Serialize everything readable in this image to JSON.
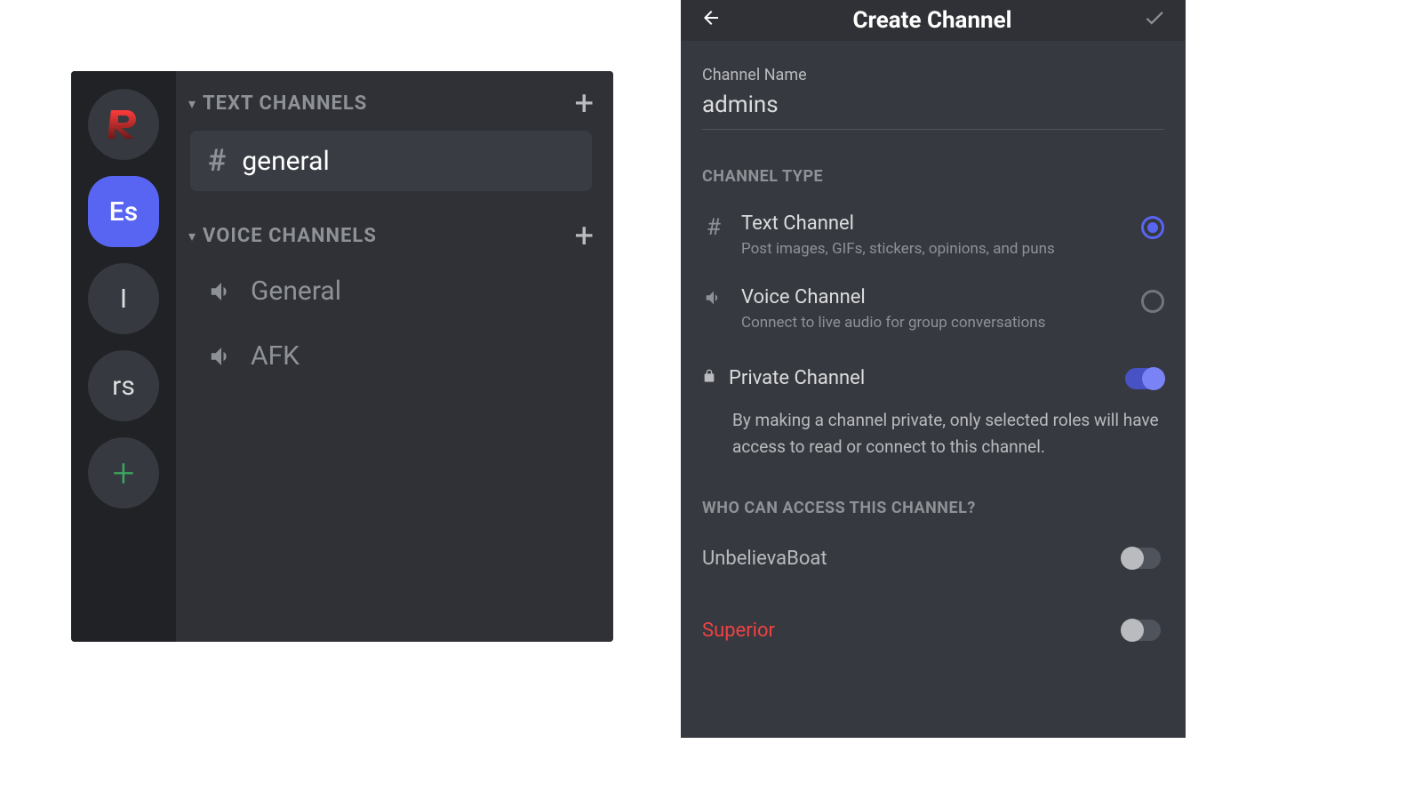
{
  "left": {
    "servers": {
      "es_label": "Es",
      "i_label": "I",
      "rs_label": "rs",
      "add_label": "+"
    },
    "text_cat": {
      "label": "TEXT CHANNELS",
      "general": "general"
    },
    "voice_cat": {
      "label": "VOICE CHANNELS",
      "general": "General",
      "afk": "AFK"
    }
  },
  "right": {
    "title": "Create Channel",
    "field_label": "Channel Name",
    "field_value": "admins",
    "type_section": "CHANNEL TYPE",
    "text_type": {
      "title": "Text Channel",
      "sub": "Post images, GIFs, stickers, opinions, and puns"
    },
    "voice_type": {
      "title": "Voice Channel",
      "sub": "Connect to live audio for group conversations"
    },
    "private_label": "Private Channel",
    "private_desc": "By making a channel private, only selected roles will have access to read or connect to this channel.",
    "access_section": "WHO CAN ACCESS THIS CHANNEL?",
    "roles": {
      "r0": "UnbelievaBoat",
      "r1": "Superior"
    }
  }
}
